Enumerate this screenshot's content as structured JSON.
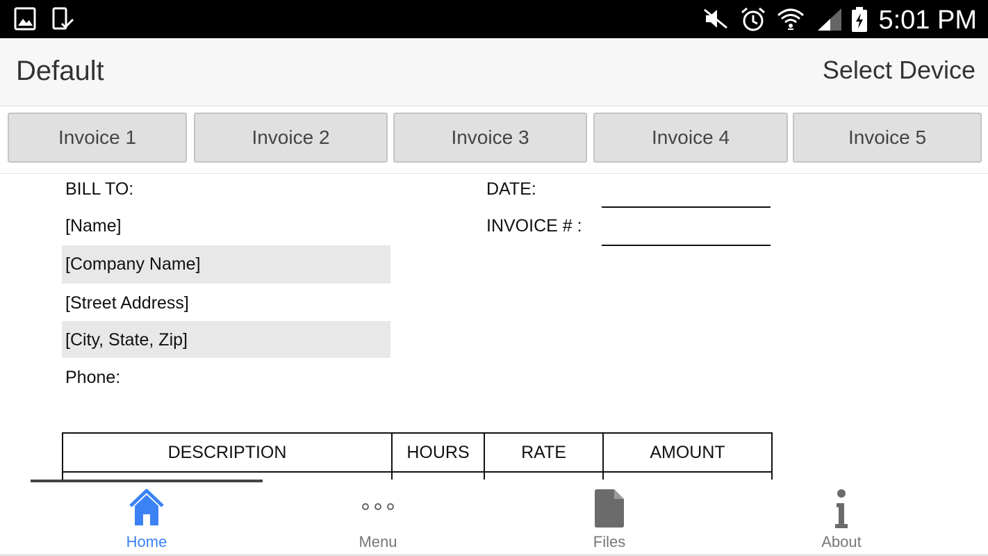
{
  "status_bar": {
    "time": "5:01 PM",
    "icons": [
      "gallery-icon",
      "device-check-icon",
      "mute-icon",
      "alarm-icon",
      "wifi-icon",
      "signal-icon",
      "battery-charging-icon"
    ]
  },
  "app_bar": {
    "title": "Default",
    "action": "Select Device"
  },
  "tabs": [
    {
      "label": "Invoice 1"
    },
    {
      "label": "Invoice 2"
    },
    {
      "label": "Invoice 3"
    },
    {
      "label": "Invoice 4"
    },
    {
      "label": "Invoice 5"
    }
  ],
  "invoice": {
    "bill_to_label": "BILL TO:",
    "name": "[Name]",
    "company": "[Company Name]",
    "street": "[Street Address]",
    "city_state_zip": "[City, State,  Zip]",
    "phone_label": "Phone:",
    "date_label": "DATE:",
    "invoice_no_label": "INVOICE # :",
    "table": {
      "headers": [
        "DESCRIPTION",
        "HOURS",
        "RATE",
        "AMOUNT"
      ]
    }
  },
  "bottom_nav": [
    {
      "label": "Home",
      "icon": "home-icon",
      "active": true
    },
    {
      "label": "Menu",
      "icon": "more-dots-icon",
      "active": false
    },
    {
      "label": "Files",
      "icon": "file-icon",
      "active": false
    },
    {
      "label": "About",
      "icon": "info-icon",
      "active": false
    }
  ],
  "colors": {
    "accent": "#3b82f6",
    "status_bar": "#000000",
    "tab_bg": "#e0e0e0",
    "row_shade": "#e8e8e8"
  }
}
